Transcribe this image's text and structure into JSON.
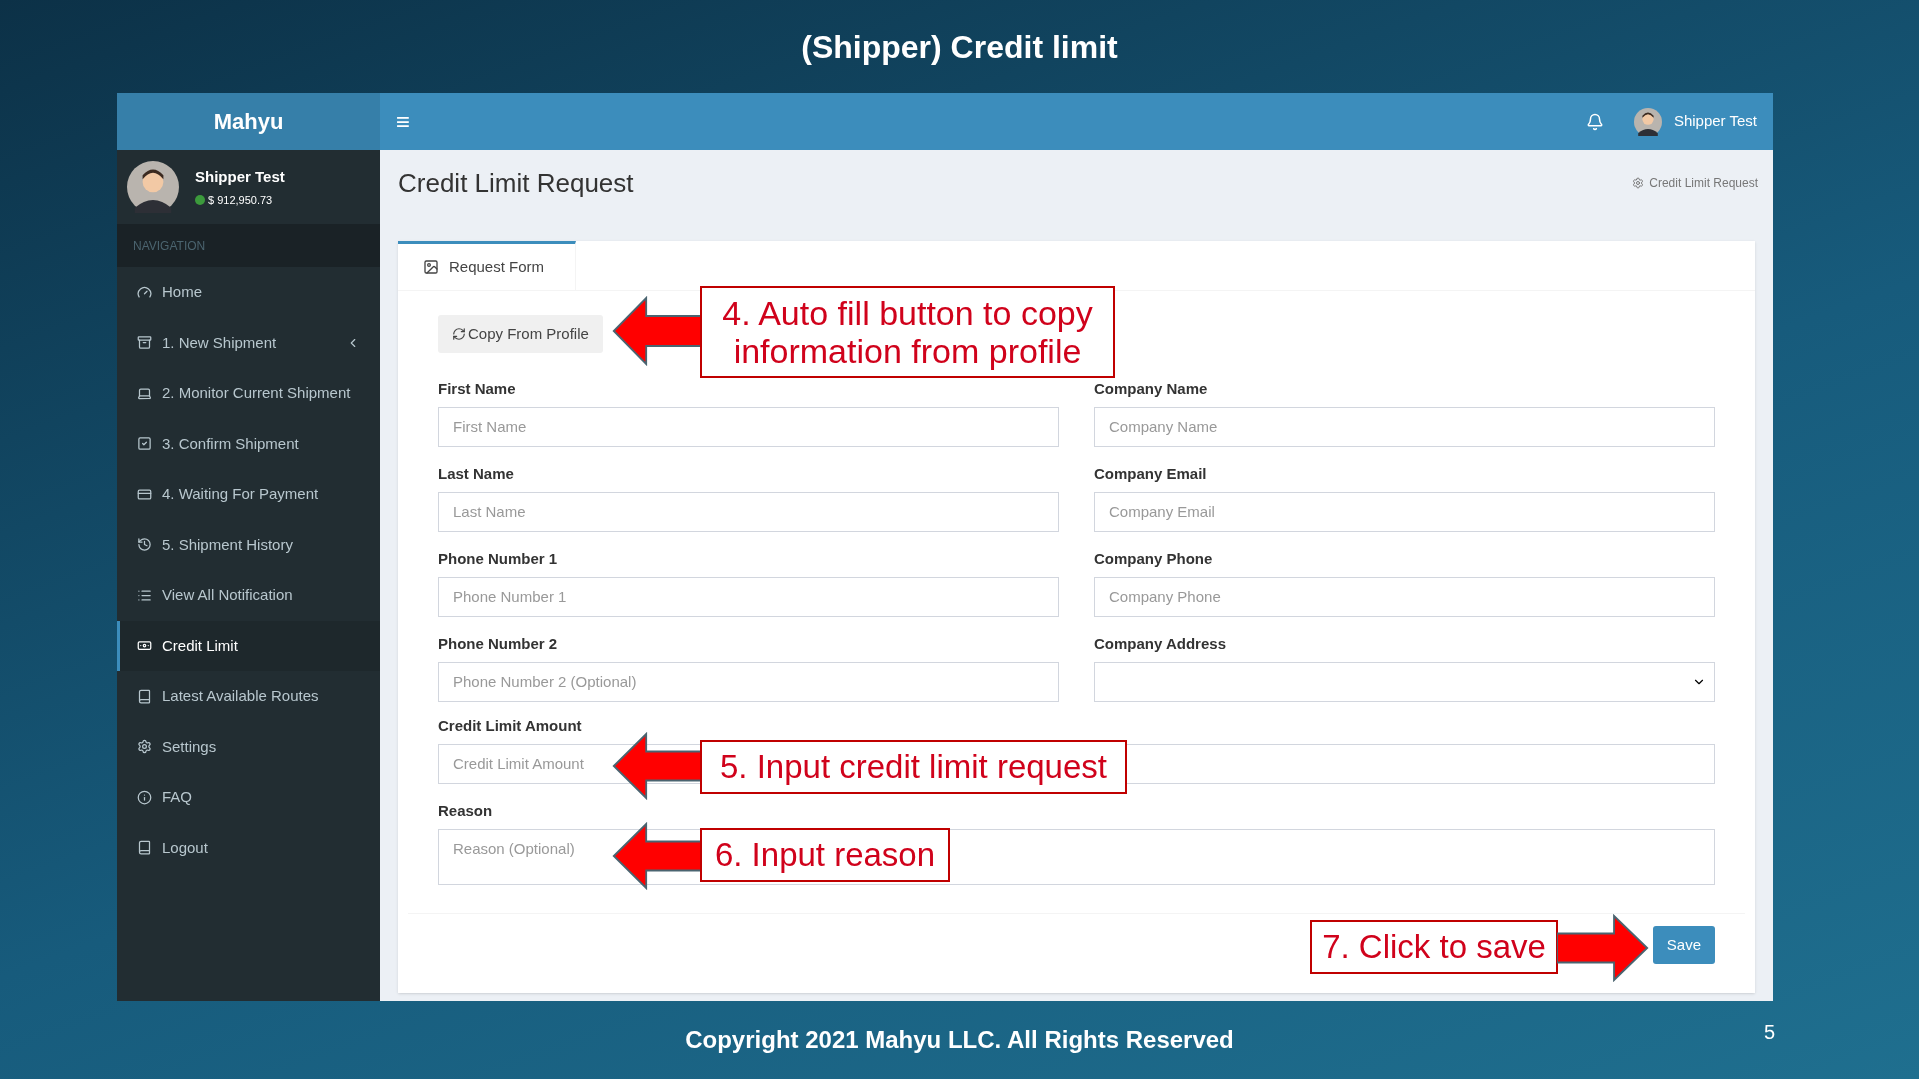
{
  "slide_title": "(Shipper) Credit limit",
  "app": {
    "brand": "Mahyu",
    "header": {
      "menu_glyph": "≡",
      "user_name": "Shipper Test"
    },
    "sidebar": {
      "user_name": "Shipper Test",
      "balance": "$ 912,950.73",
      "section_label": "NAVIGATION",
      "items": [
        {
          "label": "Home",
          "selected": false,
          "has_submenu": false
        },
        {
          "label": "1. New Shipment",
          "selected": false,
          "has_submenu": true
        },
        {
          "label": "2. Monitor Current Shipment",
          "selected": false,
          "has_submenu": false
        },
        {
          "label": "3. Confirm Shipment",
          "selected": false,
          "has_submenu": false
        },
        {
          "label": "4. Waiting For Payment",
          "selected": false,
          "has_submenu": false
        },
        {
          "label": "5. Shipment History",
          "selected": false,
          "has_submenu": false
        },
        {
          "label": "View All Notification",
          "selected": false,
          "has_submenu": false
        },
        {
          "label": "Credit Limit",
          "selected": true,
          "has_submenu": false
        },
        {
          "label": "Latest Available Routes",
          "selected": false,
          "has_submenu": false
        },
        {
          "label": "Settings",
          "selected": false,
          "has_submenu": false
        },
        {
          "label": "FAQ",
          "selected": false,
          "has_submenu": false
        },
        {
          "label": "Logout",
          "selected": false,
          "has_submenu": false
        }
      ]
    },
    "page_title": "Credit Limit Request",
    "breadcrumb": "Credit Limit Request",
    "tabs": [
      {
        "label": "Request Form",
        "selected": true
      }
    ],
    "copy_button": "Copy From Profile",
    "grid_fields": [
      {
        "label": "First Name",
        "kind": "input",
        "placeholder": "First Name"
      },
      {
        "label": "Company Name",
        "kind": "input",
        "placeholder": "Company Name"
      },
      {
        "label": "Last Name",
        "kind": "input",
        "placeholder": "Last Name"
      },
      {
        "label": "Company Email",
        "kind": "input",
        "placeholder": "Company Email"
      },
      {
        "label": "Phone Number 1",
        "kind": "input",
        "placeholder": "Phone Number 1"
      },
      {
        "label": "Company Phone",
        "kind": "input",
        "placeholder": "Company Phone"
      },
      {
        "label": "Phone Number 2",
        "kind": "input",
        "placeholder": "Phone Number 2 (Optional)"
      },
      {
        "label": "Company Address",
        "kind": "select"
      }
    ],
    "wide_fields": [
      {
        "label": "Credit Limit Amount",
        "kind": "input",
        "placeholder": "Credit Limit Amount"
      },
      {
        "label": "Reason",
        "kind": "textarea",
        "placeholder": "Reason (Optional)"
      }
    ],
    "save_button": "Save"
  },
  "callouts": [
    {
      "text": "4. Auto fill button to copy information from profile",
      "kind": "left"
    },
    {
      "text": "5. Input credit limit request",
      "kind": "left"
    },
    {
      "text": "6. Input reason",
      "kind": "left"
    },
    {
      "text": "7. Click to save",
      "kind": "right"
    }
  ],
  "footer": "Copyright 2021 Mahyu LLC. All Rights Reserved",
  "page_number": "5"
}
